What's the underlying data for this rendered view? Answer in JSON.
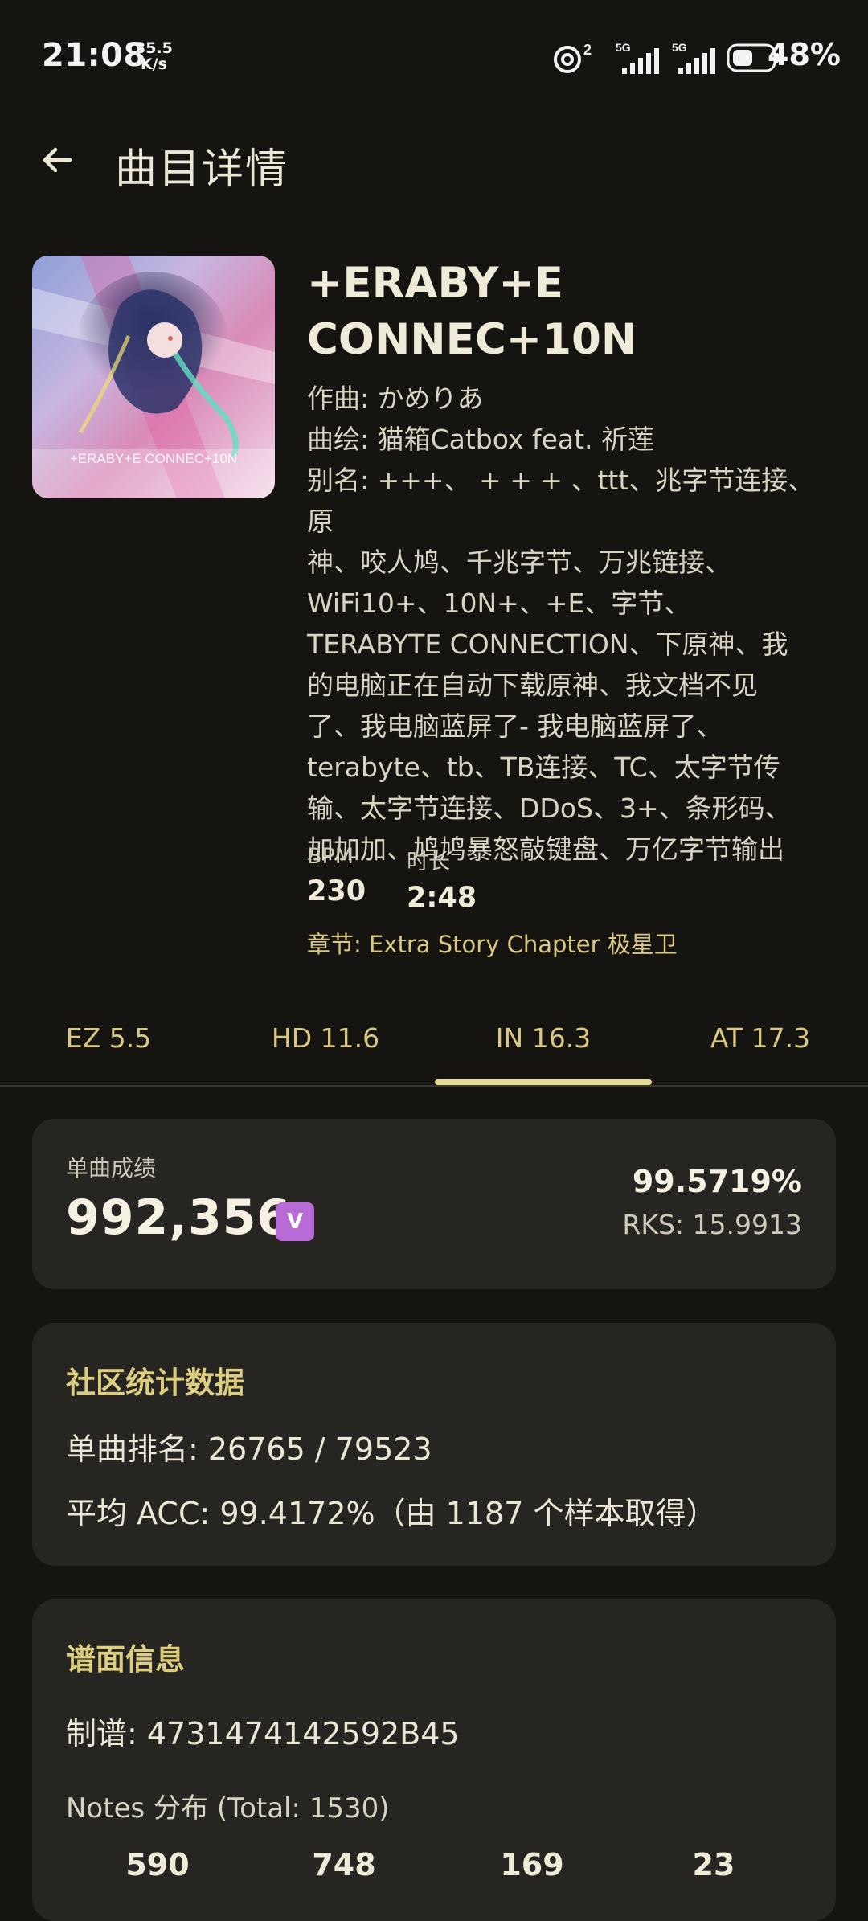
{
  "status_bar": {
    "time": "21:08",
    "net_speed_value": "35.5",
    "net_speed_unit": "K/s",
    "battery_percent": "48%"
  },
  "header": {
    "title": "曲目详情"
  },
  "song": {
    "title_line1": "+ERABY+E",
    "title_line2": "CONNEC+10N",
    "composer": "作曲: かめりあ",
    "illustrator": "曲绘: 猫箱Catbox feat. 祈莲",
    "alias_lines": [
      "别名: +++、 + + + 、ttt、兆字节连接、原",
      "神、咬人鸠、千兆字节、万兆链接、",
      "WiFi10+、10N+、+E、字节、",
      "TERABYTE CONNECTION、下原神、我",
      "的电脑正在自动下载原神、我文档不见",
      "了、我电脑蓝屏了- 我电脑蓝屏了、",
      "terabyte、tb、TB连接、TC、太字节传",
      "输、太字节连接、DDoS、3+、条形码、",
      "加加加、鸠鸠暴怒敲键盘、万亿字节输出"
    ],
    "bpm_label": "BPM",
    "bpm_value": "230",
    "duration_label": "时长",
    "duration_value": "2:48",
    "chapter": "章节: Extra Story Chapter 极星卫",
    "cover_text": "+ERABY+E CONNEC+10N"
  },
  "tabs": [
    {
      "label": "EZ 5.5"
    },
    {
      "label": "HD 11.6"
    },
    {
      "label": "IN 16.3"
    },
    {
      "label": "AT 17.3"
    }
  ],
  "active_tab": "IN 16.3",
  "score_card": {
    "label": "单曲成绩",
    "score": "992,356",
    "badge": "V",
    "accuracy": "99.5719%",
    "rks": "RKS: 15.9913"
  },
  "community": {
    "title": "社区统计数据",
    "rank": "单曲排名: 26765 / 79523",
    "avg_acc": "平均 ACC: 99.4172%（由 1187 个样本取得）"
  },
  "chart_info": {
    "title": "谱面信息",
    "charter": "制谱: 4731474142592B45",
    "notes_label": "Notes 分布 (Total: 1530)",
    "notes_counts": [
      "590",
      "748",
      "169",
      "23"
    ]
  },
  "colors": {
    "background": "#161410",
    "card": "#272521",
    "accent_gold": "#dccd80",
    "tab_indicator": "#e6dc92",
    "badge_purple": "#b86ad6"
  }
}
